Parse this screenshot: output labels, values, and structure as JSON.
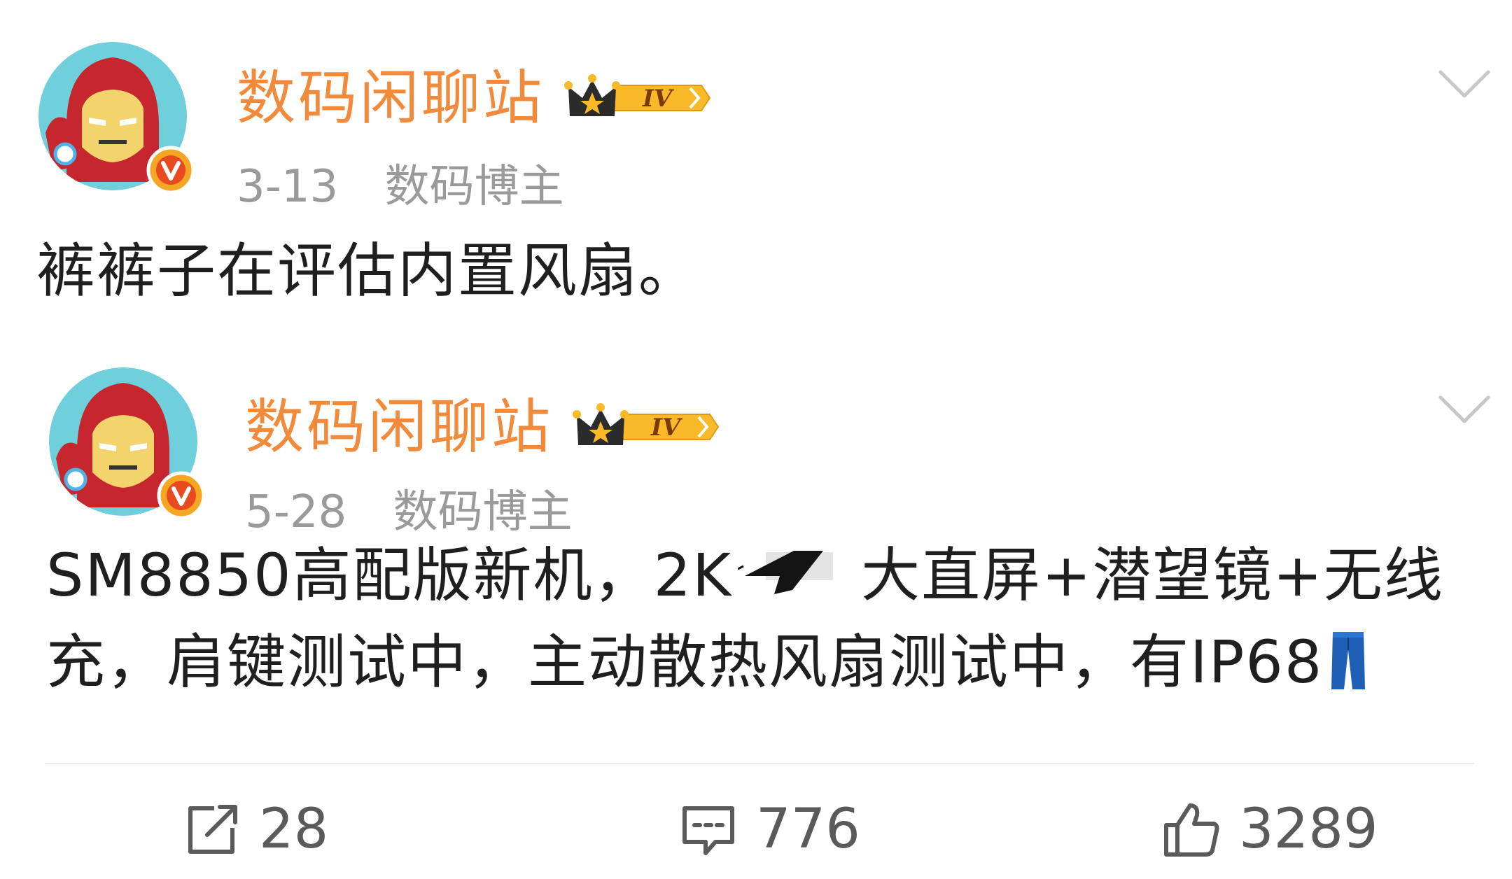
{
  "posts": [
    {
      "username": "数码闲聊站",
      "level_badge": "IV",
      "date": "3-13",
      "category": "数码博主",
      "text": "裤裤子在评估内置风扇。"
    },
    {
      "username": "数码闲聊站",
      "level_badge": "IV",
      "date": "5-28",
      "category": "数码博主",
      "text_part1": "SM8850高配版新机，2K",
      "text_part2": "大直屏+潜望镜+无线充，肩键测试中，主动散热风扇测试中，有IP68"
    }
  ],
  "actions": {
    "repost_count": "28",
    "comment_count": "776",
    "like_count": "3289"
  },
  "icons": {
    "verified_badge": "verified-v-icon",
    "vip_badge": "crown-level-icon",
    "menu": "chevron-down-icon",
    "repost": "repost-icon",
    "comment": "comment-icon",
    "like": "thumbs-up-icon",
    "emoji": "jeans-emoji-icon"
  },
  "colors": {
    "username": "#f28a3b",
    "meta": "#9a9a9a",
    "text": "#1f1f1f",
    "verified": "#f5a623"
  }
}
